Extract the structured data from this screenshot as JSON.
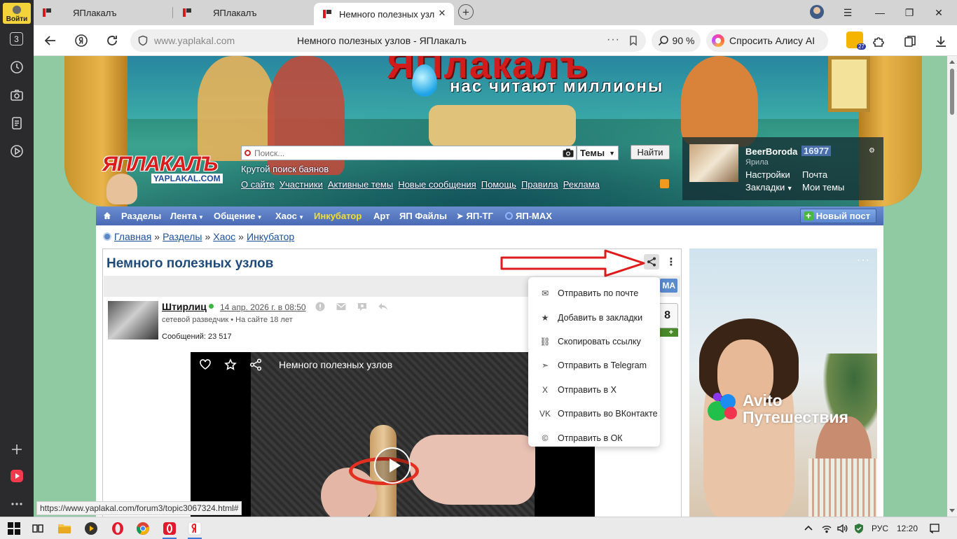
{
  "browser": {
    "sidebar": {
      "login_label": "Войти",
      "tabs_count": "3"
    },
    "tabs": [
      {
        "title": "ЯПлакалъ"
      },
      {
        "title": "ЯПлакалъ"
      },
      {
        "title": "Немного полезных узл"
      }
    ],
    "address": {
      "domain": "www.yaplakal.com",
      "page_title": "Немного полезных узлов - ЯПлакалъ",
      "dots": "···",
      "zoom": "90 %",
      "alice": "Спросить Алису AI",
      "ext_badge": "27"
    },
    "status_url": "https://www.yaplakal.com/forum3/topic3067324.html#"
  },
  "site": {
    "banner_logo": "ЯПлакалъ",
    "banner_slogan": "нас читают миллионы",
    "logo_main": "ЯПЛАКАЛЪ",
    "logo_sub": "YAPLAKAL.COM",
    "search": {
      "placeholder": "Поиск...",
      "scope": "Темы",
      "button": "Найти",
      "hint": "Крутой поиск баянов"
    },
    "top_links": [
      "О сайте",
      "Участники",
      "Активные темы",
      "Новые сообщения",
      "Помощь",
      "Правила",
      "Реклама"
    ],
    "user": {
      "name": "BeerBoroda",
      "karma": "16977",
      "rank": "Ярила",
      "links": {
        "settings": "Настройки",
        "mail": "Почта",
        "bookmarks": "Закладки",
        "my_topics": "Мои темы"
      }
    },
    "nav": {
      "items": [
        "Разделы",
        "Лента",
        "Общение",
        "Хаос",
        "Инкубатор",
        "Арт",
        "ЯП Файлы",
        "ЯП-ТГ",
        "ЯП-MAX"
      ],
      "new_post": "Новый пост"
    },
    "breadcrumb": [
      "Главная",
      "Разделы",
      "Хаос",
      "Инкубатор"
    ],
    "breadcrumb_sep": "»",
    "topic": {
      "title": "Немного полезных узлов",
      "tag": "МА",
      "post": {
        "author": "Штирлиц",
        "date": "14 апр. 2026 г. в 08:50",
        "rank": "сетевой разведчик",
        "on_site": "На сайте 18 лет",
        "messages": "Сообщений: 23 517",
        "rating": "8",
        "plus": "+"
      },
      "video": {
        "title": "Немного полезных узлов"
      }
    },
    "share_menu": [
      {
        "icon": "✉",
        "label": "Отправить по почте"
      },
      {
        "icon": "★",
        "label": "Добавить в закладки"
      },
      {
        "icon": "⛓",
        "label": "Скопировать ссылку"
      },
      {
        "icon": "➣",
        "label": "Отправить в Telegram"
      },
      {
        "icon": "X",
        "label": "Отправить в X"
      },
      {
        "icon": "VK",
        "label": "Отправить во ВКонтакте"
      },
      {
        "icon": "©",
        "label": "Отправить в ОК"
      }
    ],
    "ad": {
      "line1": "Avito",
      "line2": "Путешествия",
      "dots": "···"
    }
  },
  "taskbar": {
    "lang": "РУС",
    "time": "12:20"
  },
  "colors": {
    "page_bg": "#8fcaa3",
    "nav_bar": "#4a6ab4",
    "link": "#1c4f99",
    "topic_title": "#1f4b7a",
    "logo_red": "#d91d1d",
    "annotation_red": "#e01b1b"
  }
}
